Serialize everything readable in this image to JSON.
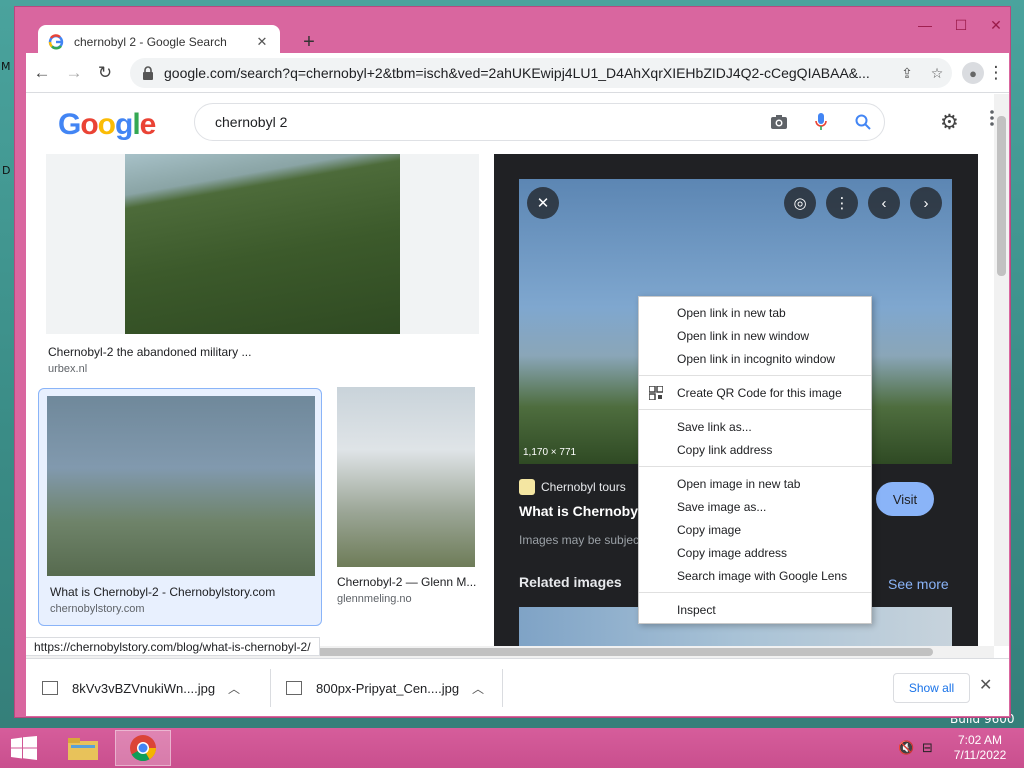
{
  "desktop": {
    "edge_label_1": "M",
    "edge_label_2": "D",
    "watermark": "Build 9600"
  },
  "window": {
    "minimize": "—",
    "maximize": "☐",
    "close": "✕"
  },
  "tab": {
    "title": "chernobyl 2 - Google Search",
    "close": "✕",
    "new_tab": "+"
  },
  "toolbar": {
    "back": "←",
    "forward": "→",
    "reload": "↻",
    "url": "google.com/search?q=chernobyl+2&tbm=isch&ved=2ahUKEwipj4LU1_D4AhXqrXIEHbZIDJ4Q2-cCegQIABAA&...",
    "share": "⇪",
    "bookmark": "☆",
    "menu": "⋮"
  },
  "google": {
    "logo_letters": [
      {
        "ch": "G",
        "color": "#4285F4"
      },
      {
        "ch": "o",
        "color": "#EA4335"
      },
      {
        "ch": "o",
        "color": "#FBBC05"
      },
      {
        "ch": "g",
        "color": "#4285F4"
      },
      {
        "ch": "l",
        "color": "#34A853"
      },
      {
        "ch": "e",
        "color": "#EA4335"
      }
    ],
    "query": "chernobyl 2"
  },
  "results": [
    {
      "title": "Chernobyl-2 the abandoned military ...",
      "source": "urbex.nl"
    },
    {
      "title": "What is Chernobyl-2 - Chernobylstory.com",
      "source": "chernobylstory.com"
    },
    {
      "title": "Chernobyl-2 — Glenn M...",
      "source": "glennmeling.no"
    }
  ],
  "preview": {
    "dims": "1,170 × 771",
    "source_name": "Chernobyl tours",
    "title": "What is Chernobyl",
    "subtitle": "Images may be subjec",
    "visit": "Visit",
    "related": "Related images",
    "see_more": "See more"
  },
  "status_url": "https://chernobylstory.com/blog/what-is-chernobyl-2/",
  "context_menu": {
    "group1": [
      "Open link in new tab",
      "Open link in new window",
      "Open link in incognito window"
    ],
    "group2": [
      "Create QR Code for this image"
    ],
    "group3": [
      "Save link as...",
      "Copy link address"
    ],
    "group4": [
      "Open image in new tab",
      "Save image as...",
      "Copy image",
      "Copy image address",
      "Search image with Google Lens"
    ],
    "group5": [
      "Inspect"
    ]
  },
  "downloads": [
    {
      "name": "8kVv3vBZVnukiWn....jpg"
    },
    {
      "name": "800px-Pripyat_Cen....jpg"
    }
  ],
  "shelf": {
    "show_all": "Show all",
    "close": "✕"
  },
  "taskbar": {
    "time": "7:02 AM",
    "date": "7/11/2022"
  },
  "colors": {
    "accent": "#d9669f",
    "link": "#1a73e8",
    "visit_btn": "#8ab4f8"
  }
}
